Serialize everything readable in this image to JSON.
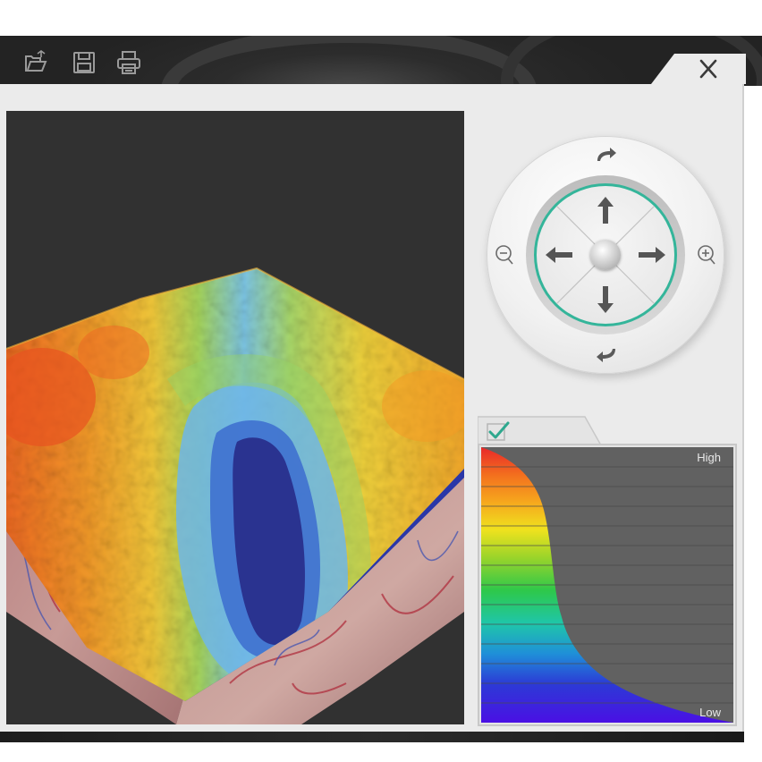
{
  "toolbar": {
    "tools": [
      {
        "name": "open-folder-icon"
      },
      {
        "name": "save-icon"
      },
      {
        "name": "print-icon"
      }
    ],
    "close_glyph": "✕"
  },
  "navigation": {
    "buttons": [
      "rotate-clockwise",
      "rotate-counterclockwise",
      "pan-up",
      "pan-down",
      "pan-left",
      "pan-right",
      "zoom-in",
      "zoom-out",
      "reset-center"
    ],
    "accent_color": "#34b59a"
  },
  "legend": {
    "enabled": true,
    "high_label": "High",
    "low_label": "Low",
    "scale_colors": [
      "#e8282a",
      "#f36f1e",
      "#f6a81d",
      "#efe21e",
      "#9bd42a",
      "#2ec84a",
      "#1fc6a9",
      "#1f8fd8",
      "#2c3ad6",
      "#4a10e4"
    ]
  },
  "viewport": {
    "background": "#313131",
    "map_colors": {
      "high": "#f08a2a",
      "mid": "#8fd36a",
      "low": "#2a3a9a"
    }
  }
}
